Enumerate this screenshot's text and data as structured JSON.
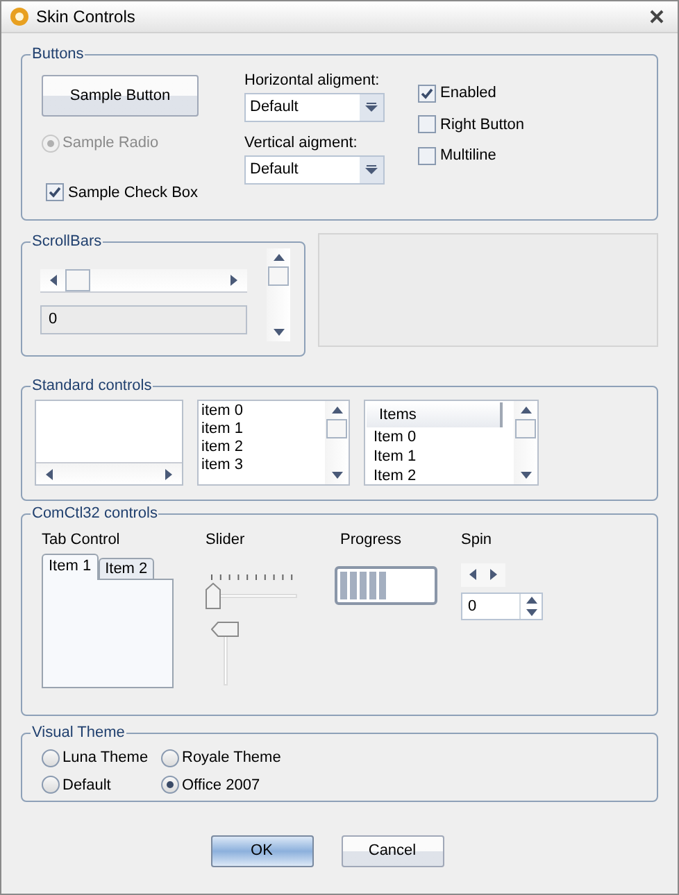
{
  "window": {
    "title": "Skin Controls"
  },
  "buttons_group": {
    "label": "Buttons",
    "sample_button": "Sample Button",
    "sample_radio": {
      "label": "Sample Radio",
      "selected": true,
      "disabled": true
    },
    "sample_checkbox": {
      "label": "Sample Check Box",
      "checked": true
    },
    "horizontal": {
      "label": "Horizontal aligment:",
      "value": "Default"
    },
    "vertical": {
      "label": "Vertical aigment:",
      "value": "Default"
    },
    "options": [
      {
        "label": "Enabled",
        "checked": true
      },
      {
        "label": "Right Button",
        "checked": false
      },
      {
        "label": "Multiline",
        "checked": false
      }
    ]
  },
  "scrollbars_group": {
    "label": "ScrollBars",
    "value": "0"
  },
  "standard_group": {
    "label": "Standard controls",
    "list_items": [
      "item 0",
      "item 1",
      "item 2",
      "item 3"
    ],
    "list_view": {
      "header": "Items",
      "rows": [
        "Item 0",
        "Item 1",
        "Item 2"
      ]
    }
  },
  "comctl_group": {
    "label": "ComCtl32 controls",
    "tab_control": {
      "label": "Tab Control",
      "tabs": [
        {
          "label": "Item 1",
          "selected": true
        },
        {
          "label": "Item 2",
          "selected": false
        }
      ]
    },
    "slider": {
      "label": "Slider",
      "level": 0
    },
    "vertical_slider": {
      "level": 1
    },
    "progress": {
      "label": "Progress",
      "level": 0.5
    },
    "spin": {
      "label": "Spin",
      "value": "0"
    }
  },
  "theme_group": {
    "label": "Visual Theme",
    "options": [
      {
        "label": "Luna Theme",
        "selected": false
      },
      {
        "label": "Royale Theme",
        "selected": false
      },
      {
        "label": "Default",
        "selected": false
      },
      {
        "label": "Office 2007",
        "selected": true
      }
    ]
  },
  "footer": {
    "ok": "OK",
    "cancel": "Cancel"
  }
}
